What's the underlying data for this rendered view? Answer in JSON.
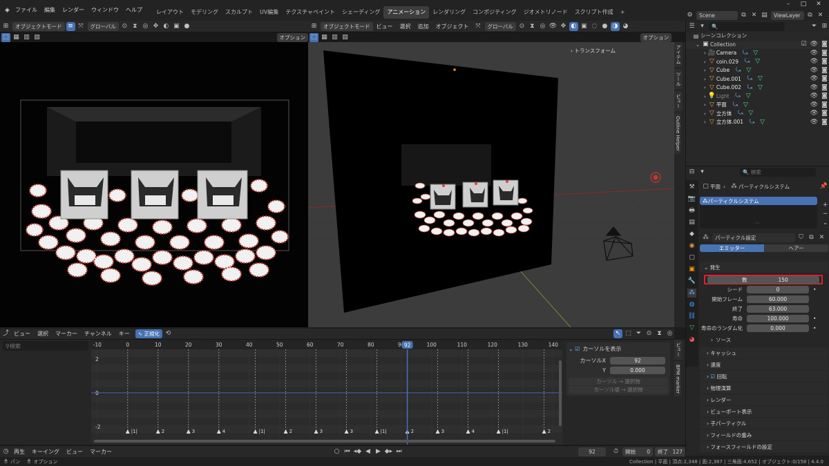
{
  "menu": {
    "items": [
      "ファイル",
      "編集",
      "レンダー",
      "ウィンドウ",
      "ヘルプ"
    ],
    "workspaces": [
      "レイアウト",
      "モデリング",
      "スカルプト",
      "UV編集",
      "テクスチャペイント",
      "シェーディング",
      "アニメーション",
      "レンダリング",
      "コンポジティング",
      "ジオメトリノード",
      "スクリプト作成"
    ],
    "active_workspace": "アニメーション",
    "add_tab": "+",
    "scene": "Scene",
    "view_layer": "ViewLayer"
  },
  "viewport_left": {
    "mode": "オブジェクトモード",
    "transform": "グローバル",
    "options": "オプション"
  },
  "viewport_right": {
    "mode": "オブジェクトモード",
    "menus": [
      "ビュー",
      "選択",
      "追加",
      "オブジェクト"
    ],
    "transform": "グローバル",
    "options": "オプション",
    "npanel_transform": "トランスフォーム",
    "side_tabs": [
      "アイテム",
      "ツール",
      "ビュー",
      "Outline Helper"
    ]
  },
  "outliner": {
    "title": "シーンコレクション",
    "collection": "Collection",
    "items": [
      {
        "name": "Camera",
        "color": "#e8e8e8",
        "dim": false
      },
      {
        "name": "coin.029",
        "color": "#e8e8e8",
        "dim": false
      },
      {
        "name": "Cube",
        "color": "#e8e8e8",
        "dim": false
      },
      {
        "name": "Cube.001",
        "color": "#e8e8e8",
        "dim": false
      },
      {
        "name": "Cube.002",
        "color": "#e8e8e8",
        "dim": false
      },
      {
        "name": "Light",
        "color": "#8a8a8a",
        "dim": true
      },
      {
        "name": "平面",
        "color": "#e8e8e8",
        "dim": false
      },
      {
        "name": "立方体",
        "color": "#e8e8e8",
        "dim": false
      },
      {
        "name": "立方体.001",
        "color": "#e8e8e8",
        "dim": false
      }
    ]
  },
  "properties": {
    "search_placeholder": "検索",
    "breadcrumb_obj": "平面",
    "breadcrumb_sys": "パーティクルシステム",
    "list_item": "パーティクルシステム",
    "settings_name": "パーティクル設定",
    "type_tabs": [
      "エミッター",
      "ヘアー"
    ],
    "emission_header": "発生",
    "emission": [
      {
        "label": "数",
        "value": "150"
      },
      {
        "label": "シード",
        "value": "0"
      },
      {
        "label": "開始フレーム",
        "value": "60.000"
      },
      {
        "label": "終了",
        "value": "63.000"
      },
      {
        "label": "寿命",
        "value": "100.000"
      },
      {
        "label": "寿命のランダム化",
        "value": "0.000"
      }
    ],
    "source": "ソース",
    "panels": [
      "キャッシュ",
      "速度",
      "回転",
      "物理演算",
      "レンダー",
      "ビューポート表示",
      "子パーティクル",
      "フィールドの重み",
      "フォースフィールドの設定"
    ]
  },
  "graph": {
    "menus": [
      "ビュー",
      "選択",
      "マーカー",
      "チャンネル",
      "キー"
    ],
    "normalize": "正規化",
    "search_placeholder": "検索",
    "frames": [
      -10,
      0,
      10,
      20,
      30,
      40,
      50,
      60,
      70,
      80,
      90,
      100,
      110,
      120,
      130,
      140
    ],
    "current_frame": 92,
    "y_ticks": [
      "2",
      "0",
      "-2"
    ],
    "markers": [
      {
        "frame": 0,
        "label": "|1|"
      },
      {
        "frame": 10,
        "label": "2"
      },
      {
        "frame": 20,
        "label": "3"
      },
      {
        "frame": 30,
        "label": "4"
      },
      {
        "frame": 42,
        "label": "|1|"
      },
      {
        "frame": 52,
        "label": "2"
      },
      {
        "frame": 62,
        "label": "3"
      },
      {
        "frame": 72,
        "label": "3"
      },
      {
        "frame": 82,
        "label": "|1|"
      },
      {
        "frame": 92,
        "label": "2"
      },
      {
        "frame": 102,
        "label": "3"
      },
      {
        "frame": 112,
        "label": "4"
      },
      {
        "frame": 122,
        "label": "|1|"
      },
      {
        "frame": 137,
        "label": "2"
      }
    ],
    "panel": {
      "show_cursor": "カーソルを表示",
      "cursor_x_label": "カーソルX",
      "cursor_x": "92",
      "y_label": "Y",
      "y_value": "0.000",
      "btn1": "カーソル → 選択物",
      "btn2": "カーソル値 → 選択物"
    },
    "side_tabs": [
      "ビュー",
      "BPM marker"
    ]
  },
  "timeline": {
    "playback": "再生",
    "keying": "キーイング",
    "view": "ビュー",
    "marker": "マーカー",
    "frame": "92",
    "start_label": "開始",
    "start": "0",
    "end_label": "終了",
    "end": "127"
  },
  "status": {
    "left1": "パン",
    "left2": "オプション",
    "stats": "Collection | 平面 | 頂点:2,348 | 面:2,387 | 三角面:4,652 | オブジェクト:0/158 | 4.4.0"
  }
}
